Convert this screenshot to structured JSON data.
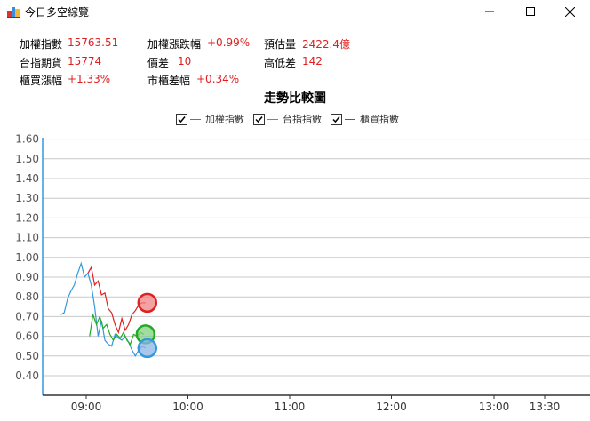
{
  "window": {
    "title": "今日多空綜覽",
    "minimize_label": "minimize",
    "maximize_label": "maximize",
    "close_label": "close"
  },
  "stats": {
    "weighted_index_label": "加權指數",
    "weighted_index_value": "15763.51",
    "weighted_change_label": "加權漲跌幅",
    "weighted_change_value": "+0.99%",
    "volume_est_label": "預估量",
    "volume_est_value": "2422.4億",
    "taifex_label": "台指期貨",
    "taifex_value": "15774",
    "spread_label": "價差",
    "spread_value": "10",
    "hilo_label": "高低差",
    "hilo_value": "142",
    "otc_change_label": "櫃買漲幅",
    "otc_change_value": "+1.33%",
    "otc_spread_label": "市櫃差幅",
    "otc_spread_value": "+0.34%"
  },
  "colors": {
    "weighted": "#22aa22",
    "taifex": "#3399dd",
    "otc": "#dd2222",
    "value_text": "#e02020",
    "grid": "#c8c8c8",
    "axis": "#3399dd"
  },
  "chart_data": {
    "type": "line",
    "title": "走勢比較圖",
    "xlabel": "",
    "ylabel": "",
    "x_ticks": [
      "09:00",
      "10:00",
      "11:00",
      "12:00",
      "13:00",
      "13:30"
    ],
    "y_ticks": [
      "0.40",
      "0.50",
      "0.60",
      "0.70",
      "0.80",
      "0.90",
      "1.00",
      "1.10",
      "1.20",
      "1.30",
      "1.40",
      "1.50",
      "1.60"
    ],
    "ylim": [
      0.35,
      1.6
    ],
    "grid": true,
    "legend_position": "top-center",
    "legend": [
      {
        "name": "加權指數",
        "checked": true
      },
      {
        "name": "台指指數",
        "checked": true
      },
      {
        "name": "櫃買指數",
        "checked": true
      }
    ],
    "series": [
      {
        "name": "台指指數",
        "color_key": "taifex",
        "x": [
          "08:45",
          "08:47",
          "08:49",
          "08:51",
          "08:53",
          "08:55",
          "08:57",
          "08:59",
          "09:01",
          "09:03",
          "09:05",
          "09:07",
          "09:09",
          "09:11",
          "09:13",
          "09:15",
          "09:17",
          "09:19",
          "09:21",
          "09:23",
          "09:25",
          "09:27",
          "09:29",
          "09:31",
          "09:33",
          "09:35"
        ],
        "values": [
          0.71,
          0.72,
          0.79,
          0.83,
          0.86,
          0.92,
          0.97,
          0.9,
          0.92,
          0.86,
          0.75,
          0.6,
          0.68,
          0.58,
          0.56,
          0.55,
          0.61,
          0.59,
          0.58,
          0.6,
          0.57,
          0.53,
          0.5,
          0.53,
          0.55,
          0.54
        ]
      },
      {
        "name": "加權指數",
        "color_key": "weighted",
        "x": [
          "09:02",
          "09:04",
          "09:06",
          "09:08",
          "09:10",
          "09:12",
          "09:14",
          "09:16",
          "09:18",
          "09:20",
          "09:22",
          "09:24",
          "09:26",
          "09:28",
          "09:30",
          "09:32",
          "09:34"
        ],
        "values": [
          0.6,
          0.71,
          0.66,
          0.7,
          0.64,
          0.66,
          0.61,
          0.58,
          0.61,
          0.59,
          0.62,
          0.58,
          0.56,
          0.61,
          0.6,
          0.62,
          0.61
        ]
      },
      {
        "name": "櫃買指數",
        "color_key": "otc",
        "x": [
          "09:01",
          "09:03",
          "09:05",
          "09:07",
          "09:09",
          "09:11",
          "09:13",
          "09:15",
          "09:17",
          "09:19",
          "09:21",
          "09:23",
          "09:25",
          "09:27",
          "09:29",
          "09:31",
          "09:33",
          "09:35"
        ],
        "values": [
          0.92,
          0.95,
          0.86,
          0.88,
          0.81,
          0.82,
          0.74,
          0.72,
          0.66,
          0.62,
          0.69,
          0.63,
          0.66,
          0.71,
          0.73,
          0.76,
          0.77,
          0.77
        ]
      }
    ],
    "end_markers": [
      {
        "series": "櫃買指數",
        "x": "09:35",
        "value": 0.77
      },
      {
        "series": "加權指數",
        "x": "09:34",
        "value": 0.61
      },
      {
        "series": "台指指數",
        "x": "09:35",
        "value": 0.54
      }
    ]
  }
}
